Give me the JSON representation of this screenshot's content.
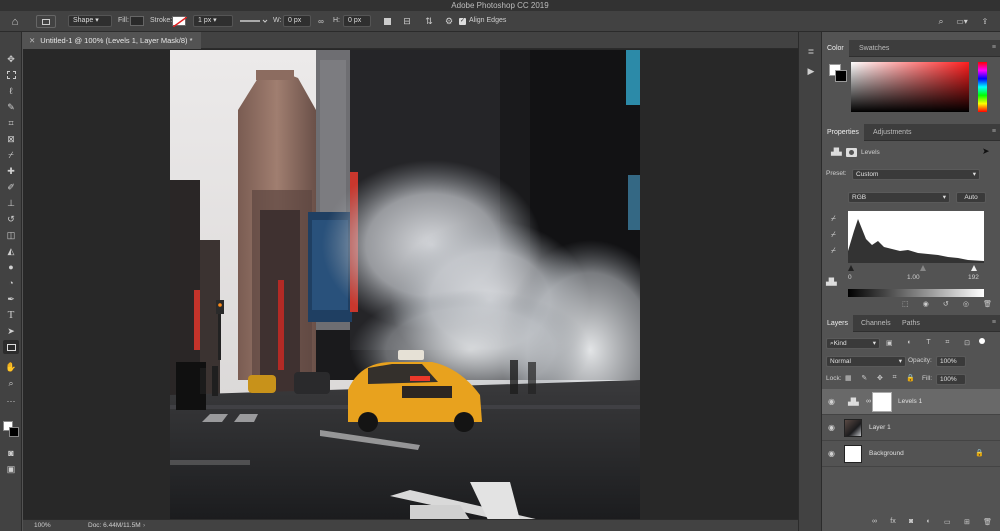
{
  "window": {
    "title": "Adobe Photoshop CC 2019"
  },
  "options_bar": {
    "shape_mode": "Shape",
    "fill_label": "Fill:",
    "stroke_label": "Stroke:",
    "stroke_width": "1 px",
    "w_label": "W:",
    "w_value": "0 px",
    "h_label": "H:",
    "h_value": "0 px",
    "align_edges": "Align Edges"
  },
  "document": {
    "tab_title": "Untitled-1 @ 100% (Levels 1, Layer Mask/8) *"
  },
  "status": {
    "zoom": "100%",
    "doc": "Doc: 6.44M/11.5M"
  },
  "color_panel": {
    "tabs": [
      "Color",
      "Swatches"
    ]
  },
  "properties_panel": {
    "tabs": [
      "Properties",
      "Adjustments"
    ],
    "adjustment": "Levels",
    "preset_label": "Preset:",
    "preset_value": "Custom",
    "channel": "RGB",
    "auto_label": "Auto",
    "input_black": "0",
    "input_gamma": "1.00",
    "input_white": "192"
  },
  "layers_panel": {
    "tabs": [
      "Layers",
      "Channels",
      "Paths"
    ],
    "filter": "Kind",
    "blend_mode": "Normal",
    "opacity_label": "Opacity:",
    "opacity_value": "100%",
    "lock_label": "Lock:",
    "fill_label": "Fill:",
    "fill_value": "100%",
    "layers": [
      {
        "name": "Levels 1"
      },
      {
        "name": "Layer 1"
      },
      {
        "name": "Background"
      }
    ]
  },
  "colors": {
    "accent": "#1473e6",
    "panel": "#535353",
    "canvas_bg": "#282828",
    "foreground": "#ffffff",
    "background": "#000000"
  }
}
